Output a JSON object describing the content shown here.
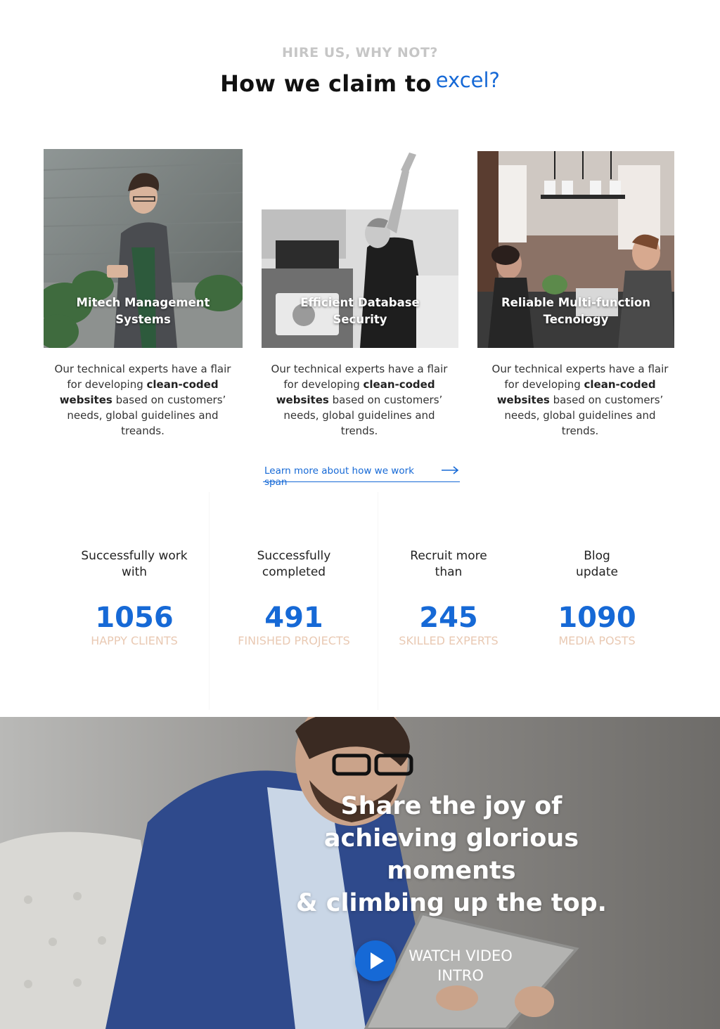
{
  "section": {
    "eyebrow": "HIRE US, WHY NOT?",
    "headline_main": "How we claim to",
    "headline_accent": "excel?"
  },
  "cards": [
    {
      "title": "Mitech Management Systems",
      "desc_1": "Our technical experts have a flair for developing ",
      "desc_bold": "clean-coded websites",
      "desc_2": " based on customers’ needs, global guidelines and treands."
    },
    {
      "title": "Efficient Database Security",
      "desc_1": "Our technical experts have a flair for developing ",
      "desc_bold": "clean-coded websites",
      "desc_2": " based on customers’ needs, global guidelines and trends."
    },
    {
      "title": "Reliable Multi-function Tecnology",
      "desc_1": "Our technical experts have a flair for developing ",
      "desc_bold": "clean-coded websites",
      "desc_2": " based on customers’ needs, global guidelines and trends."
    }
  ],
  "learn_more": {
    "label": "Learn more about how we work span",
    "icon": "arrow-right-icon"
  },
  "stats": [
    {
      "label": "Successfully work with",
      "number": "1056",
      "caption": "HAPPY CLIENTS"
    },
    {
      "label": "Successfully completed",
      "number": "491",
      "caption": "FINISHED PROJECTS"
    },
    {
      "label": "Recruit more than",
      "number": "245",
      "caption": "SKILLED EXPERTS"
    },
    {
      "label": "Blog update",
      "number": "1090",
      "caption": "MEDIA POSTS"
    }
  ],
  "hero": {
    "line_1": "Share the joy of",
    "line_2": "achieving glorious",
    "line_3": "moments",
    "line_4": "& climbing up the top.",
    "watch_label": "WATCH VIDEO INTRO",
    "play_icon": "play-icon"
  },
  "colors": {
    "accent": "#1669d6",
    "caption": "#e9c9b3",
    "eyebrow": "#c6c6c6"
  }
}
